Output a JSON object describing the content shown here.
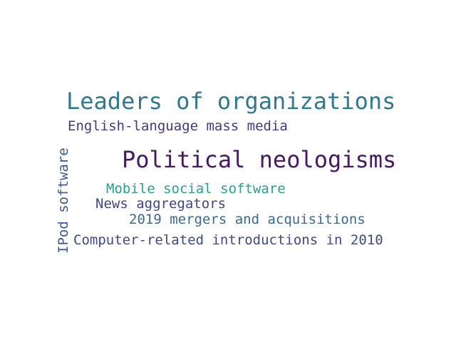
{
  "words": [
    {
      "text": "Leaders of organizations",
      "color": "#31788e"
    },
    {
      "text": "English-language mass media",
      "color": "#443a83"
    },
    {
      "text": "Political neologisms",
      "color": "#461a62"
    },
    {
      "text": "Mobile social software",
      "color": "#2a9f8e"
    },
    {
      "text": "News aggregators",
      "color": "#414487"
    },
    {
      "text": "2019 mergers and acquisitions",
      "color": "#3b6a8d"
    },
    {
      "text": "Computer-related introductions in 2010",
      "color": "#3e4a89"
    },
    {
      "text": "IPod software",
      "color": "#3b5b8b"
    }
  ]
}
